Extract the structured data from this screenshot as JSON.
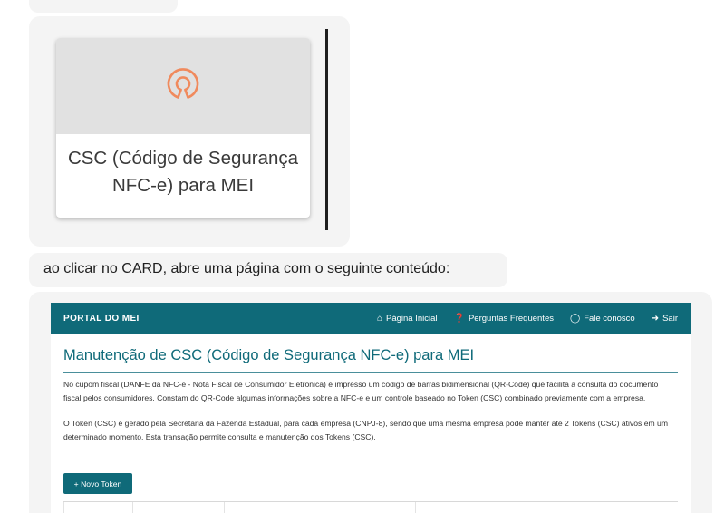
{
  "card": {
    "icon": "open-source-icon",
    "title": "CSC (Código de Segurança NFC-e) para MEI",
    "accent_color": "#f08a5d"
  },
  "message": {
    "text": "ao clicar no CARD, abre uma página com o seguinte conteúdo:"
  },
  "portal": {
    "brand": "PORTAL DO MEI",
    "nav": [
      {
        "label": "Página Inicial",
        "icon": "home-icon"
      },
      {
        "label": "Perguntas Frequentes",
        "icon": "question-icon"
      },
      {
        "label": "Fale conosco",
        "icon": "chat-icon"
      },
      {
        "label": "Sair",
        "icon": "logout-icon"
      }
    ],
    "title": "Manutenção de CSC (Código de Segurança NFC-e) para MEI",
    "paragraphs": [
      "No cupom fiscal (DANFE da NFC-e - Nota Fiscal de Consumidor Eletrônica) é impresso um código de barras bidimensional (QR-Code) que facilita a consulta do documento fiscal pelos consumidores. Constam do QR-Code algumas informações sobre a NFC-e e um controle baseado no Token (CSC) combinado previamente com a empresa.",
      "O Token (CSC) é gerado pela Secretaria da Fazenda Estadual, para cada empresa (CNPJ-8), sendo que uma mesma empresa pode manter até 2 Tokens (CSC) ativos em um determinado momento. Esta transação permite consulta e manutenção dos Tokens (CSC)."
    ],
    "new_token_button": "+ Novo Token",
    "brand_color": "#0f6a79"
  }
}
